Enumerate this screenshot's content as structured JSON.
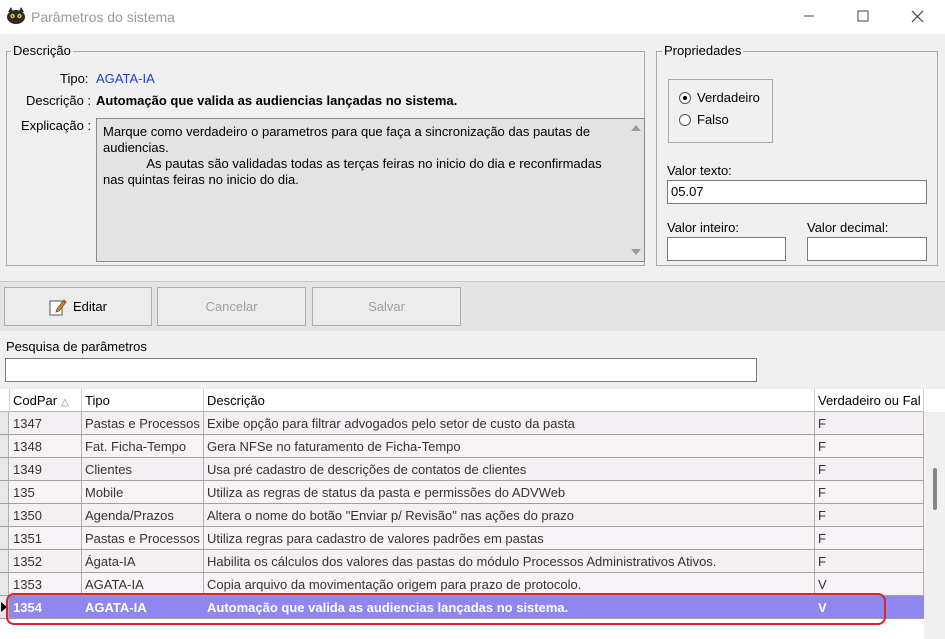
{
  "window": {
    "title": "Parâmetros do sistema",
    "icon": "cat-logo-icon"
  },
  "descricao_group": {
    "legend": "Descrição",
    "tipo_label": "Tipo:",
    "tipo_value": "AGATA-IA",
    "descricao_label": "Descrição :",
    "descricao_value": "Automação que valida as audiencias lançadas no sistema.",
    "explicacao_label": "Explicação :",
    "explicacao_value": "Marque como verdadeiro o parametros para que faça a sincronização das pautas de audiencias.\n            As pautas são validadas todas as terças feiras no inicio do dia e reconfirmadas nas quintas feiras no inicio do dia."
  },
  "propriedades_group": {
    "legend": "Propriedades",
    "radio_true": "Verdadeiro",
    "radio_false": "Falso",
    "selected": "Verdadeiro",
    "valor_texto_label": "Valor texto:",
    "valor_texto": "05.07",
    "valor_inteiro_label": "Valor inteiro:",
    "valor_inteiro": "",
    "valor_decimal_label": "Valor decimal:",
    "valor_decimal": ""
  },
  "toolbar": {
    "editar": "Editar",
    "cancelar": "Cancelar",
    "salvar": "Salvar"
  },
  "search": {
    "label": "Pesquisa de parâmetros",
    "value": ""
  },
  "grid": {
    "columns": [
      "CodPar",
      "Tipo",
      "Descrição",
      "Verdadeiro ou Fal"
    ],
    "rows": [
      {
        "cod": "1347",
        "tipo": "Pastas e Processos",
        "desc": "Exibe opção para filtrar advogados pelo setor de custo da pasta",
        "vf": "F"
      },
      {
        "cod": "1348",
        "tipo": "Fat. Ficha-Tempo",
        "desc": "Gera NFSe no faturamento de Ficha-Tempo",
        "vf": "F"
      },
      {
        "cod": "1349",
        "tipo": "Clientes",
        "desc": "Usa pré cadastro de descrições de contatos de clientes",
        "vf": "F"
      },
      {
        "cod": "135",
        "tipo": "Mobile",
        "desc": "Utiliza as regras de status da pasta e permissões do ADVWeb",
        "vf": "F"
      },
      {
        "cod": "1350",
        "tipo": "Agenda/Prazos",
        "desc": "Altera o nome do botão \"Enviar p/ Revisão\" nas ações do prazo",
        "vf": "F"
      },
      {
        "cod": "1351",
        "tipo": "Pastas e Processos",
        "desc": "Utiliza regras para cadastro de valores padrões em pastas",
        "vf": "F"
      },
      {
        "cod": "1352",
        "tipo": "Ágata-IA",
        "desc": "Habilita os cálculos dos valores das pastas do módulo Processos Administrativos Ativos.",
        "vf": "F"
      },
      {
        "cod": "1353",
        "tipo": "AGATA-IA",
        "desc": "Copia arquivo da movimentação origem para prazo de protocolo.",
        "vf": "V"
      },
      {
        "cod": "1354",
        "tipo": "AGATA-IA",
        "desc": "Automação que valida as audiencias lançadas no sistema.",
        "vf": "V",
        "selected": true
      }
    ]
  }
}
